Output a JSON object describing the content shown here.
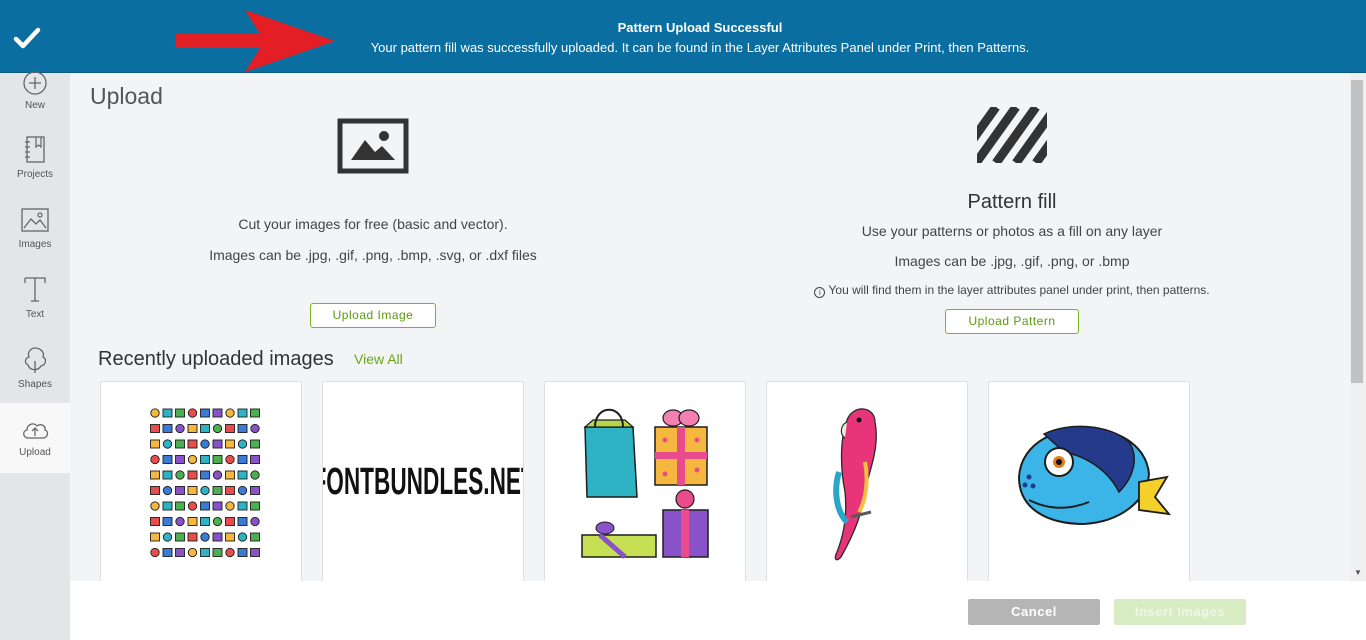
{
  "banner": {
    "title": "Pattern Upload Successful",
    "message": "Your pattern fill was successfully uploaded. It can be found in the Layer Attributes Panel under Print, then Patterns.",
    "icon": "checkmark-icon",
    "bg_color": "#0b6ea0"
  },
  "sidebar": {
    "items": [
      {
        "label": "New",
        "icon": "plus-circle-icon"
      },
      {
        "label": "Projects",
        "icon": "notebook-icon"
      },
      {
        "label": "Images",
        "icon": "image-icon"
      },
      {
        "label": "Text",
        "icon": "text-icon"
      },
      {
        "label": "Shapes",
        "icon": "shapes-icon"
      },
      {
        "label": "Upload",
        "icon": "cloud-upload-icon",
        "active": true
      }
    ]
  },
  "main": {
    "title": "Upload",
    "image_upload": {
      "line1": "Cut your images for free (basic and vector).",
      "line2": "Images can be .jpg, .gif, .png, .bmp, .svg, or .dxf files",
      "button": "Upload Image"
    },
    "pattern_upload": {
      "title": "Pattern fill",
      "line1": "Use your patterns or photos as a fill on any layer",
      "line2": "Images can be .jpg, .gif, .png, or .bmp",
      "note": "You will find them in the layer attributes panel under print, then patterns.",
      "button": "Upload Pattern"
    },
    "recent": {
      "title": "Recently uploaded images",
      "view_all": "View All",
      "thumbnails": [
        {
          "name": "icon-grid-thumbnail"
        },
        {
          "name": "fontbundles-thumbnail",
          "text": "FONTBUNDLES.NET"
        },
        {
          "name": "gifts-thumbnail"
        },
        {
          "name": "parrot-thumbnail"
        },
        {
          "name": "fish-thumbnail"
        }
      ]
    }
  },
  "footer": {
    "cancel": "Cancel",
    "insert": "Insert Images"
  },
  "colors": {
    "accent_green": "#7ab51d",
    "banner_blue": "#0b6ea0"
  }
}
